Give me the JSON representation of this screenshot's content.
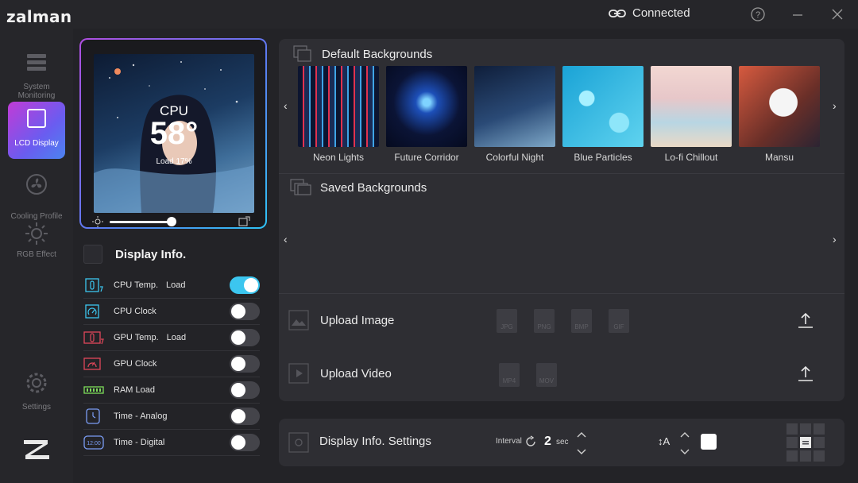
{
  "app": {
    "brand": "zalman",
    "connection": "Connected"
  },
  "nav": {
    "items": [
      {
        "label": "System Monitoring",
        "icon": "system-monitoring-icon"
      },
      {
        "label": "LCD Display",
        "icon": "lcd-display-icon",
        "active": true
      },
      {
        "label": "Cooling Profile",
        "icon": "fan-icon"
      },
      {
        "label": "RGB Effect",
        "icon": "sun-icon"
      },
      {
        "label": "Settings",
        "icon": "gear-icon"
      }
    ]
  },
  "preview": {
    "metric": "CPU",
    "value": "58°",
    "sub": "Load 17%",
    "brightness": 0.78
  },
  "display_info": {
    "title": "Display Info.",
    "rows": [
      {
        "label": "CPU Temp.",
        "extra": "Load",
        "on": true,
        "icon": "cpu-temp-icon"
      },
      {
        "label": "CPU Clock",
        "extra": "",
        "on": false,
        "icon": "cpu-clock-icon"
      },
      {
        "label": "GPU Temp.",
        "extra": "Load",
        "on": false,
        "icon": "gpu-temp-icon"
      },
      {
        "label": "GPU Clock",
        "extra": "",
        "on": false,
        "icon": "gpu-clock-icon"
      },
      {
        "label": "RAM Load",
        "extra": "",
        "on": false,
        "icon": "ram-icon"
      },
      {
        "label": "Time - Analog",
        "extra": "",
        "on": false,
        "icon": "clock-icon"
      },
      {
        "label": "Time - Digital",
        "extra": "",
        "on": false,
        "icon": "digital-clock-icon"
      }
    ]
  },
  "backgrounds": {
    "default_title": "Default Backgrounds",
    "saved_title": "Saved Backgrounds",
    "items": [
      {
        "name": "Neon Lights"
      },
      {
        "name": "Future Corridor"
      },
      {
        "name": "Colorful Night"
      },
      {
        "name": "Blue Particles"
      },
      {
        "name": "Lo-fi Chillout"
      },
      {
        "name": "Mansu"
      }
    ]
  },
  "upload": {
    "image_label": "Upload Image",
    "video_label": "Upload Video",
    "image_formats": [
      "JPG",
      "PNG",
      "BMP",
      "GIF"
    ],
    "video_formats": [
      "MP4",
      "MOV"
    ]
  },
  "settings_bar": {
    "title": "Display Info. Settings",
    "interval_label": "Interval",
    "interval_value": "2",
    "interval_unit": "sec",
    "font_size_label": "↕A"
  },
  "colors": {
    "accent": "#3cc6ef",
    "active_nav_start": "#c13bd6",
    "active_nav_end": "#4b84f0"
  }
}
